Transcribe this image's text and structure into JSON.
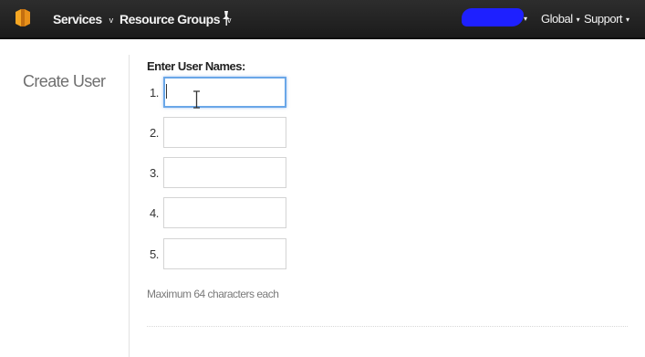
{
  "topbar": {
    "logo_icon": "aws-cube-icon",
    "services_label": "Services",
    "resource_groups_label": "Resource Groups",
    "pin_icon": "pushpin-icon",
    "region_label": "Global",
    "support_label": "Support",
    "caret": "▾"
  },
  "page": {
    "title": "Create User"
  },
  "form": {
    "label": "Enter User Names:",
    "rows": [
      {
        "number": "1.",
        "value": ""
      },
      {
        "number": "2.",
        "value": ""
      },
      {
        "number": "3.",
        "value": ""
      },
      {
        "number": "4.",
        "value": ""
      },
      {
        "number": "5.",
        "value": ""
      }
    ],
    "hint": "Maximum 64 characters each"
  },
  "colors": {
    "topbar_bg": "#232323",
    "account_redaction": "#1e20ff",
    "focus_border": "#6aa7e8",
    "logo_orange": "#f39c1a"
  }
}
